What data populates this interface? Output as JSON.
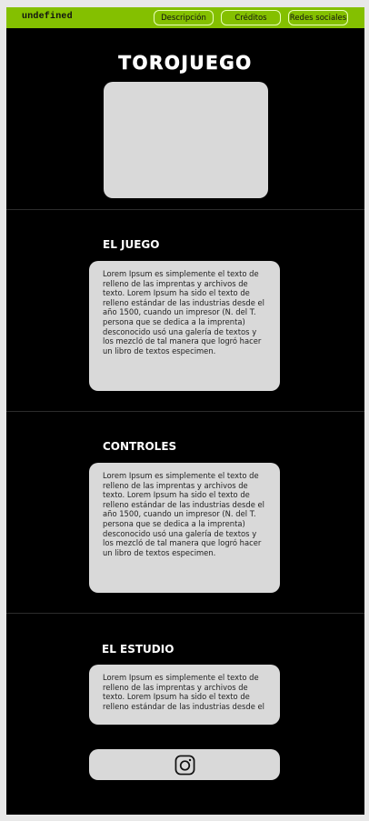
{
  "navbar": {
    "brand": "undefined",
    "links": [
      "Descripción",
      "Créditos",
      "Redes sociales"
    ]
  },
  "hero": {
    "title": "TOROJUEGO"
  },
  "sections": {
    "juego": {
      "title": "EL JUEGO",
      "body": "Lorem Ipsum es simplemente el texto de relleno de las imprentas y archivos de texto. Lorem Ipsum ha sido el texto de relleno estándar de las industrias desde el año 1500, cuando un impresor (N. del T. persona que se dedica a la imprenta) desconocido usó una galería de textos y los mezcló de tal manera que logró hacer un libro de textos especimen."
    },
    "controles": {
      "title": "CONTROLES",
      "body": "Lorem Ipsum es simplemente el texto de relleno de las imprentas y archivos de texto. Lorem Ipsum ha sido el texto de relleno estándar de las industrias desde el año 1500, cuando un impresor (N. del T. persona que se dedica a la imprenta) desconocido usó una galería de textos y los mezcló de tal manera que logró hacer un libro de textos especimen."
    },
    "estudio": {
      "title": "EL ESTUDIO",
      "body": "Lorem Ipsum es simplemente el texto de relleno de las imprentas y archivos de texto. Lorem Ipsum ha sido el texto de relleno estándar de las industrias desde el"
    }
  },
  "social": {
    "icon": "instagram-icon"
  },
  "colors": {
    "navbar_bg": "#84c000",
    "page_bg": "#000000",
    "card_bg": "#d9d9d9"
  }
}
